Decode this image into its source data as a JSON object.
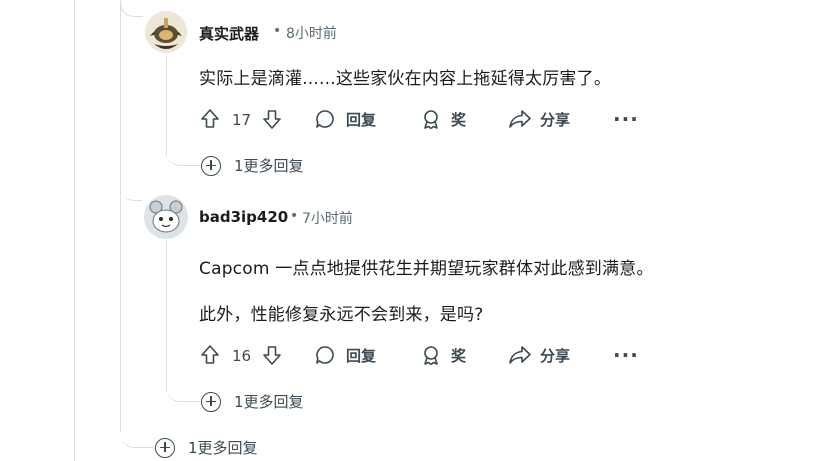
{
  "comments": [
    {
      "username": "真实武器",
      "separator": "•",
      "time": "8小时前",
      "body": [
        "实际上是滴灌......这些家伙在内容上拖延得太厉害了。"
      ],
      "upvotes": "17",
      "reply_label": "回复",
      "award_label": "奖",
      "share_label": "分享",
      "more_label": "···",
      "more_replies": "1更多回复"
    },
    {
      "username": "bad3ip420",
      "separator": "•",
      "time": "7小时前",
      "body": [
        "Capcom 一点点地提供花生并期望玩家群体对此感到满意。",
        "此外，性能修复永远不会到来，是吗?"
      ],
      "upvotes": "16",
      "reply_label": "回复",
      "award_label": "奖",
      "share_label": "分享",
      "more_label": "···",
      "more_replies": "1更多回复"
    }
  ],
  "thread_more_replies": "1更多回复",
  "colors": {
    "thread_line": "#dadde0",
    "icon": "#3c4a52",
    "meta": "#5c6c74"
  },
  "icons": [
    "upvote-icon",
    "downvote-icon",
    "comment-icon",
    "award-icon",
    "share-icon",
    "plus-circle-icon"
  ]
}
